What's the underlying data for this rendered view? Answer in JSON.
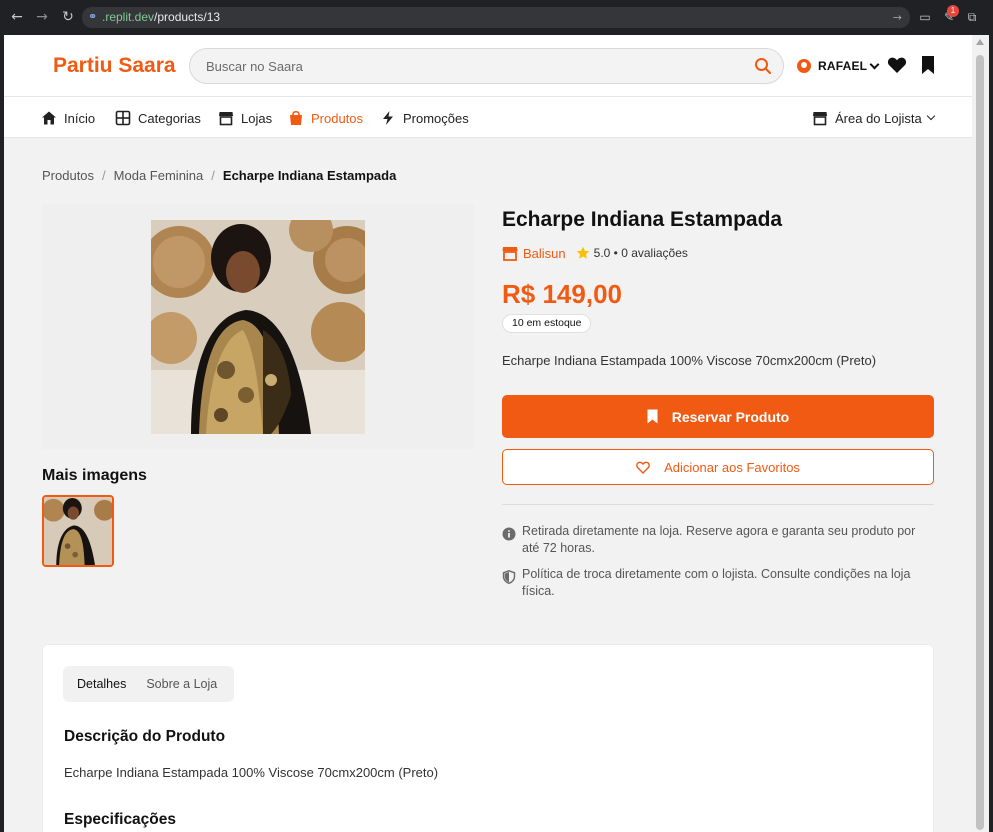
{
  "browser": {
    "url_host": ".replit.dev",
    "url_path": "/products/13",
    "extension_badge": "1"
  },
  "header": {
    "logo": "Partiu Saara",
    "search_placeholder": "Buscar no Saara",
    "user_name": "RAFAEL"
  },
  "nav": {
    "items": [
      {
        "label": "Início",
        "icon": "home-icon"
      },
      {
        "label": "Categorias",
        "icon": "grid-icon"
      },
      {
        "label": "Lojas",
        "icon": "store-icon"
      },
      {
        "label": "Produtos",
        "icon": "bag-icon"
      },
      {
        "label": "Promoções",
        "icon": "bolt-icon"
      }
    ],
    "right_label": "Área do Lojista"
  },
  "breadcrumb": {
    "items": [
      "Produtos",
      "Moda Feminina"
    ],
    "separator": "/",
    "current": "Echarpe Indiana Estampada"
  },
  "gallery": {
    "more_images_title": "Mais imagens"
  },
  "product": {
    "title": "Echarpe Indiana Estampada",
    "store_name": "Balisun",
    "rating": "5.0 • 0 avaliações",
    "price": "R$ 149,00",
    "stock": "10 em estoque",
    "short_description": "Echarpe Indiana Estampada 100% Viscose 70cmx200cm (Preto)",
    "reserve_label": "Reservar Produto",
    "favorite_label": "Adicionar aos Favoritos",
    "info": [
      "Retirada diretamente na loja. Reserve agora e garanta seu produto por até 72 horas.",
      "Política de troca diretamente com o lojista. Consulte condições na loja física."
    ]
  },
  "details": {
    "tabs": [
      "Detalhes",
      "Sobre a Loja"
    ],
    "description_title": "Descrição do Produto",
    "description_text": "Echarpe Indiana Estampada 100% Viscose 70cmx200cm (Preto)",
    "specs_title": "Especificações"
  },
  "colors": {
    "accent": "#f05a12",
    "page_bg": "#f2f2f2"
  }
}
